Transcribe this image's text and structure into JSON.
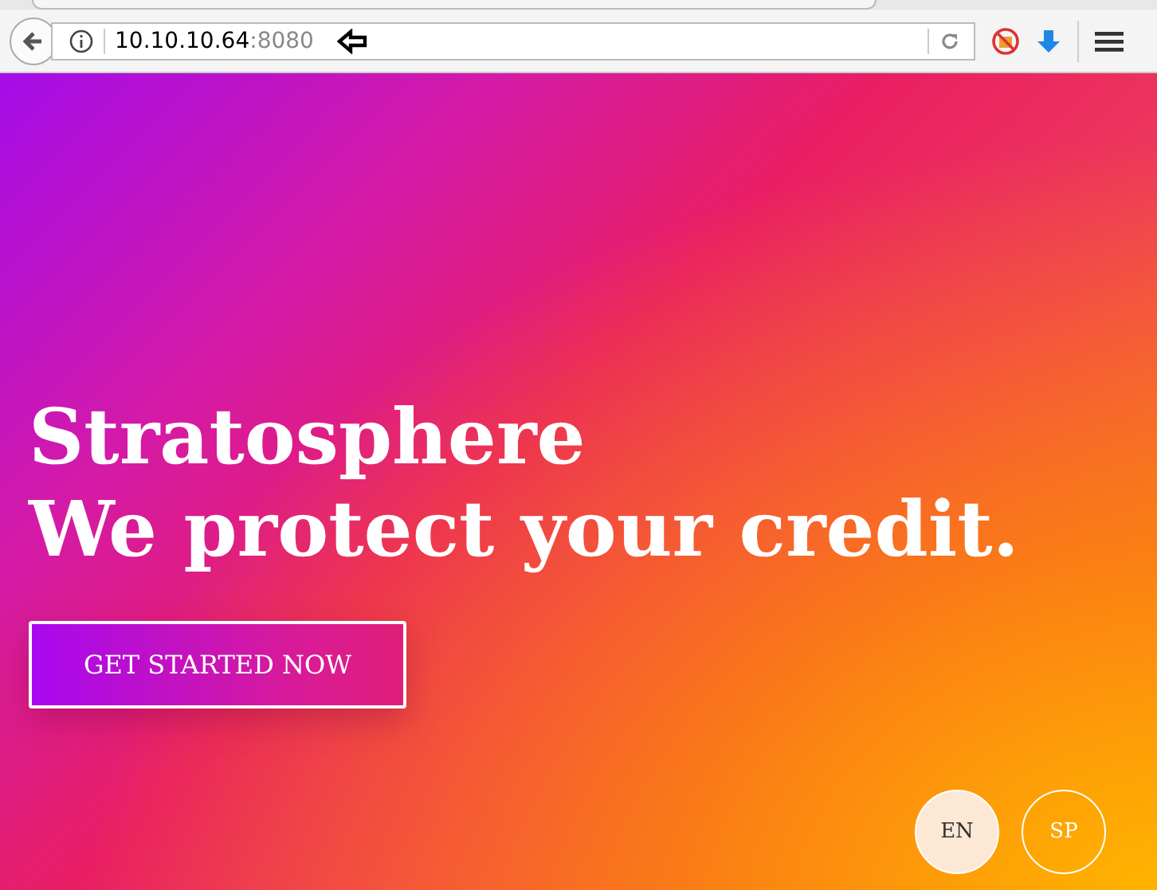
{
  "browser": {
    "url_host": "10.10.10.64",
    "url_port": ":8080"
  },
  "hero": {
    "title": "Stratosphere",
    "tagline": "We protect your credit.",
    "cta": "GET STARTED NOW"
  },
  "languages": [
    {
      "label": "EN",
      "selected": true
    },
    {
      "label": "SP",
      "selected": false
    }
  ]
}
